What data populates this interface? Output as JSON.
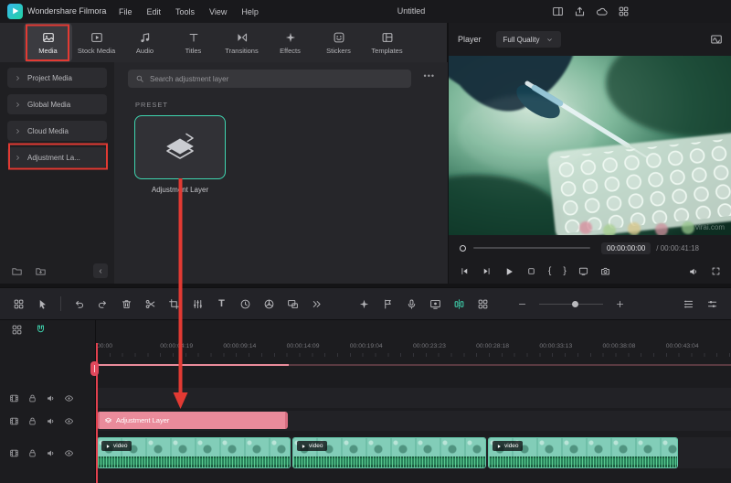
{
  "colors": {
    "accent": "#3fd6b0",
    "annotation": "#e23a33",
    "adjustment_clip": "#ea8b9b",
    "video_thumb": "#82cdb8",
    "audio_waveform": "#1d5c41"
  },
  "titlebar": {
    "app_name": "Wondershare Filmora",
    "menus": [
      "File",
      "Edit",
      "Tools",
      "View",
      "Help"
    ],
    "project_title": "Untitled"
  },
  "tabs": [
    {
      "label": "Media",
      "active": true
    },
    {
      "label": "Stock Media"
    },
    {
      "label": "Audio"
    },
    {
      "label": "Titles"
    },
    {
      "label": "Transitions"
    },
    {
      "label": "Effects"
    },
    {
      "label": "Stickers"
    },
    {
      "label": "Templates"
    }
  ],
  "sidebar": {
    "items": [
      "Project Media",
      "Global Media",
      "Cloud Media",
      "Adjustment La..."
    ]
  },
  "library": {
    "search_placeholder": "Search adjustment layer",
    "more_menu": "•••",
    "section_label": "PRESET",
    "preset_name": "Adjustment Layer"
  },
  "player": {
    "panel_label": "Player",
    "quality_selected": "Full Quality",
    "timecode_current": "00:00:00:00",
    "timecode_total": "/ 00:00:41:18",
    "watermark": "virai.com"
  },
  "glyphs": {
    "mark_in": "{",
    "mark_out": "}",
    "text_tool": "T",
    "collapse_sidebar": "‹"
  },
  "timeline": {
    "ruler_labels": [
      "00:00",
      "00:00:04:19",
      "00:00:09:14",
      "00:00:14:09",
      "00:00:19:04",
      "00:00:23:23",
      "00:00:28:18",
      "00:00:33:13",
      "00:00:38:08",
      "00:00:43:04"
    ],
    "adjustment_clip_label": "Adjustment Layer",
    "video_clips": [
      {
        "label": "video"
      },
      {
        "label": "video"
      },
      {
        "label": "video"
      }
    ]
  }
}
